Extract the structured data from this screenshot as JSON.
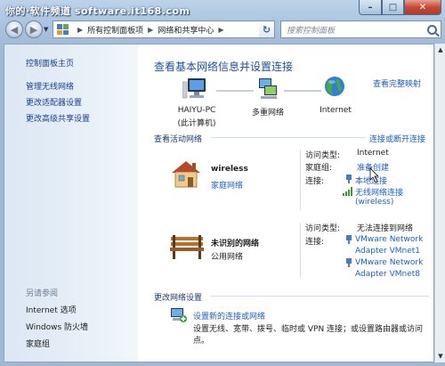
{
  "watermark": "你的·软件频道 software.it168.com",
  "window_buttons": {
    "minimize": "–",
    "maximize": "□",
    "close": "✕"
  },
  "breadcrumb": {
    "items": [
      "所有控制面板项",
      "网络和共享中心"
    ],
    "separator": "▶"
  },
  "search": {
    "placeholder": "搜索控制面板"
  },
  "sidebar": {
    "home": "控制面板主页",
    "items": [
      "管理无线网络",
      "更改适配器设置",
      "更改高级共享设置"
    ],
    "see_also_title": "另请参阅",
    "see_also": [
      "Internet 选项",
      "Windows 防火墙",
      "家庭组"
    ]
  },
  "main": {
    "title": "查看基本网络信息并设置连接",
    "full_map": "查看完整映射",
    "map": {
      "pc_name": "HAIYU-PC",
      "pc_sub": "(此计算机)",
      "multi_network": "多重网络",
      "internet": "Internet"
    },
    "active_header": "查看活动网络",
    "connect_link": "连接或断开连接",
    "networks": [
      {
        "name": "wireless",
        "type": "家庭网络",
        "access_label": "访问类型:",
        "access_value": "Internet",
        "homegroup_label": "家庭组:",
        "homegroup_value": "准备创建",
        "conn_label": "连接:",
        "conn_values": [
          "本地连接",
          "无线网络连接",
          "(wireless)"
        ]
      },
      {
        "name": "未识别的网络",
        "type": "公用网络",
        "access_label": "访问类型:",
        "access_value": "无法连接到网络",
        "conn_label": "连接:",
        "conn_values": [
          "VMware Network",
          "Adapter VMnet1",
          "VMware Network",
          "Adapter VMnet8"
        ]
      }
    ],
    "change_header": "更改网络设置",
    "setup_link": "设置新的连接或网络",
    "setup_desc": "设置无线、宽带、拨号、临时或 VPN 连接；或设置路由器或访问点。"
  },
  "colors": {
    "link": "#1b5fc1",
    "title": "#1e4f9c",
    "sidebar_link": "#1b3f8f"
  }
}
